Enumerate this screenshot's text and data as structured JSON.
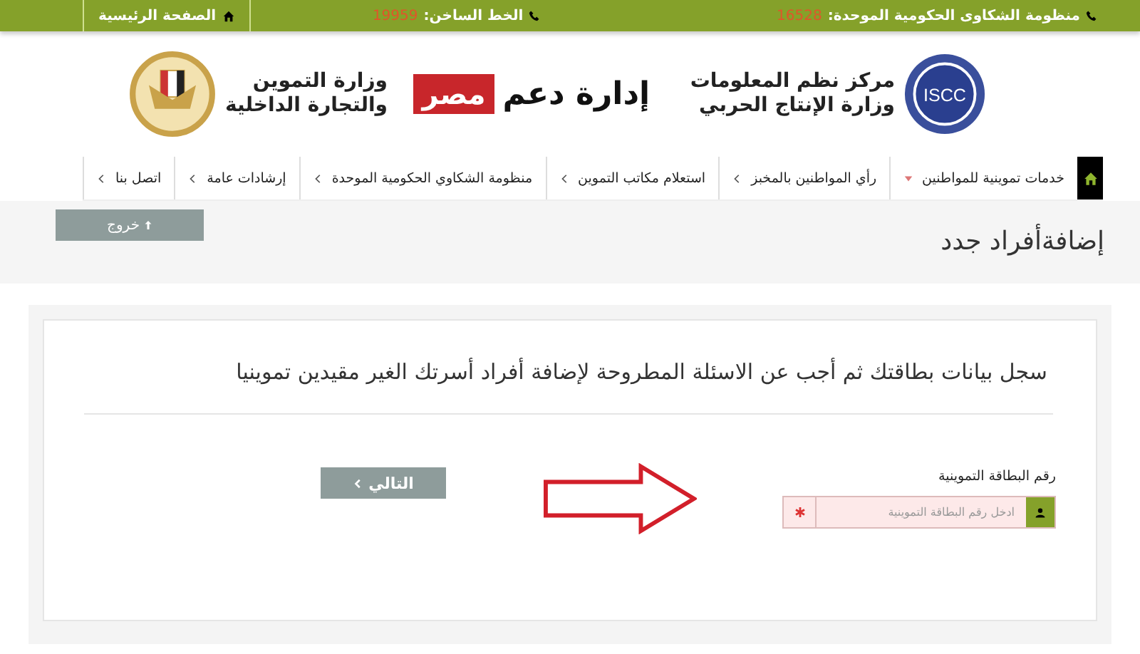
{
  "top_bar": {
    "complaints": {
      "label": "منظومة الشكاوى الحكومية الموحدة:",
      "number": "16528"
    },
    "hotline": {
      "label": "الخط الساخن:",
      "number": "19959"
    },
    "home_link": "الصفحة الرئيسية"
  },
  "header": {
    "left_org": [
      "مركز نظم المعلومات",
      "وزارة الإنتاج الحربي"
    ],
    "iscc_logo": "ISCC",
    "center_logo": {
      "text": "إدارة دعم",
      "highlight": "مصر"
    },
    "right_org": [
      "وزارة التموين",
      "والتجارة الداخلية"
    ]
  },
  "nav": [
    {
      "label": "خدمات تموينية للمواطنين",
      "kind": "dropdown"
    },
    {
      "label": "رأي المواطنين بالمخبز",
      "kind": "link"
    },
    {
      "label": "استعلام مكاتب التموين",
      "kind": "link"
    },
    {
      "label": "منظومة الشكاوي الحكومية الموحدة",
      "kind": "link"
    },
    {
      "label": "إرشادات عامة",
      "kind": "link"
    },
    {
      "label": "اتصل بنا",
      "kind": "link"
    }
  ],
  "page_title": "إضافةأفراد جدد",
  "exit_button": "خروج",
  "form": {
    "heading": "سجل بيانات بطاقتك ثم أجب عن الاسئلة المطروحة لإضافة أفراد أسرتك الغير مقيدين تموينيا",
    "field_label": "رقم البطاقة التموينية",
    "placeholder": "ادخل رقم البطاقة التموينية",
    "required": true,
    "next_button": "التالي"
  }
}
